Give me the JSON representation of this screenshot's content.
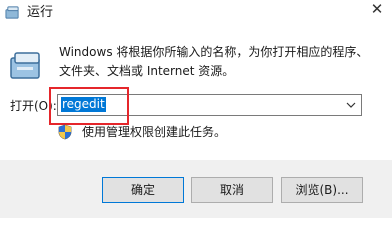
{
  "window": {
    "title": "运行",
    "close_glyph": "✕"
  },
  "description": "Windows 将根据你所输入的名称，为你打开相应的程序、文件夹、文档或 Internet 资源。",
  "open": {
    "label": "打开(O):",
    "value": "regedit"
  },
  "admin_note": "使用管理权限创建此任务。",
  "buttons": {
    "ok": "确定",
    "cancel": "取消",
    "browse": "浏览(B)..."
  },
  "colors": {
    "selection": "#0078d7",
    "highlight_border": "#e5262b",
    "footer_bg": "#f0f0f0"
  },
  "icons": {
    "title": "run-icon",
    "main": "run-icon",
    "dropdown": "chevron-down-icon",
    "admin": "shield-icon"
  }
}
